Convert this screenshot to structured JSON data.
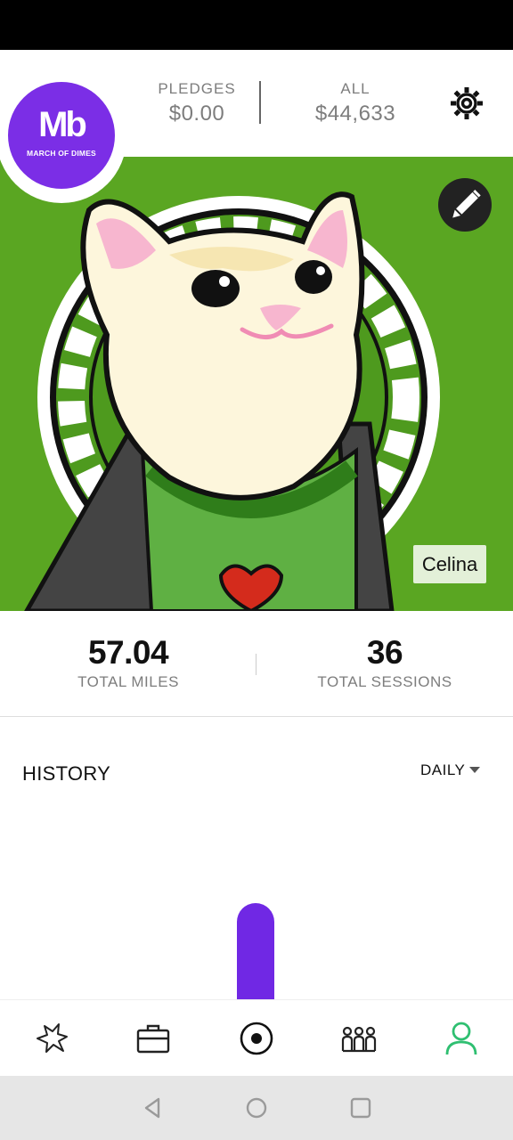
{
  "header": {
    "pledges_label": "PLEDGES",
    "pledges_value": "$0.00",
    "all_label": "ALL",
    "all_value": "$44,633",
    "settings_icon": "gear-icon"
  },
  "logo": {
    "mark": "Mb",
    "text": "MARCH OF DIMES",
    "color": "#7b2ee6"
  },
  "profile": {
    "name": "Celina",
    "edit_icon": "pencil-icon",
    "photo_background": "#5aa622"
  },
  "stats": {
    "miles_value": "57.04",
    "miles_label": "TOTAL MILES",
    "sessions_value": "36",
    "sessions_label": "TOTAL SESSIONS"
  },
  "history": {
    "title": "HISTORY",
    "period": "DAILY",
    "bar_color": "#7028e4"
  },
  "tabs": [
    {
      "name": "activity-icon"
    },
    {
      "name": "briefcase-icon"
    },
    {
      "name": "record-icon"
    },
    {
      "name": "teams-icon"
    },
    {
      "name": "profile-icon",
      "active": true,
      "color": "#2fbf71"
    }
  ],
  "system_nav": [
    "back-icon",
    "home-icon",
    "recents-icon"
  ]
}
